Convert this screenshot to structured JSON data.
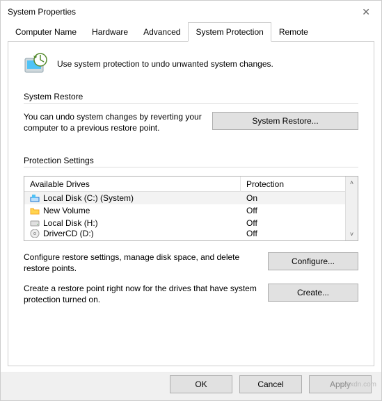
{
  "window": {
    "title": "System Properties"
  },
  "tabs": {
    "computer_name": "Computer Name",
    "hardware": "Hardware",
    "advanced": "Advanced",
    "system_protection": "System Protection",
    "remote": "Remote"
  },
  "intro_text": "Use system protection to undo unwanted system changes.",
  "section_restore": {
    "title": "System Restore",
    "desc": "You can undo system changes by reverting your computer to a previous restore point.",
    "button": "System Restore..."
  },
  "section_protection": {
    "title": "Protection Settings",
    "header_drives": "Available Drives",
    "header_protection": "Protection",
    "drives": [
      {
        "name": "Local Disk (C:) (System)",
        "protection": "On",
        "icon": "hdd-win"
      },
      {
        "name": "New Volume",
        "protection": "Off",
        "icon": "folder"
      },
      {
        "name": "Local Disk (H:)",
        "protection": "Off",
        "icon": "hdd"
      },
      {
        "name": "DriverCD (D:)",
        "protection": "Off",
        "icon": "disc"
      }
    ],
    "configure_desc": "Configure restore settings, manage disk space, and delete restore points.",
    "configure_btn": "Configure...",
    "create_desc": "Create a restore point right now for the drives that have system protection turned on.",
    "create_btn": "Create..."
  },
  "buttons": {
    "ok": "OK",
    "cancel": "Cancel",
    "apply": "Apply"
  },
  "watermark": "wsxdn.com"
}
